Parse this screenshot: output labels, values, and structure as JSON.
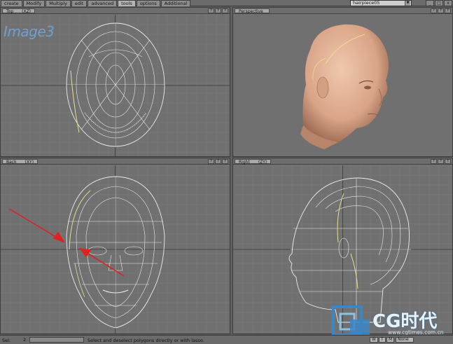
{
  "tabs": [
    {
      "label": "create",
      "active": false
    },
    {
      "label": "Modify",
      "active": false
    },
    {
      "label": "Multiply",
      "active": false
    },
    {
      "label": "edit",
      "active": false
    },
    {
      "label": "advanced",
      "active": false
    },
    {
      "label": "tools",
      "active": true
    },
    {
      "label": "options",
      "active": false
    },
    {
      "label": "Additional",
      "active": false
    }
  ],
  "layer_dropdown": {
    "value": "hairpiece05",
    "icon": "chevron-down-icon"
  },
  "window_buttons": [
    "_",
    "□",
    "x"
  ],
  "watermark": "Image3",
  "viewports": {
    "top": {
      "name": "Top",
      "axes": "(XZ)",
      "buttons": [
        "?",
        "?",
        "?"
      ]
    },
    "perspective": {
      "name": "Perspective",
      "buttons": [
        "?",
        "?",
        "?"
      ]
    },
    "back": {
      "name": "Back",
      "axes": "(XY)",
      "buttons": [
        "?",
        "?",
        "?"
      ]
    },
    "right": {
      "name": "Right",
      "axes": "(ZY)",
      "buttons": [
        "?",
        "?",
        "?"
      ]
    }
  },
  "status": {
    "label": "Sel:",
    "count": "2",
    "message": "Select and deselect polygons directly or with lasso.",
    "right_buttons": [
      "W",
      "T",
      "M",
      "None"
    ]
  },
  "logo": {
    "text": "CG时代",
    "url": "www.cgtimes.com.cn"
  },
  "colors": {
    "viewport_bg": "#707070",
    "grid": "#7c7c7c",
    "mesh": "#ececec",
    "hair_guide": "#e6e28a",
    "annotation_arrow": "#e0211e",
    "skin": "#e2b193",
    "watermark": "#6f9fd3",
    "logo_blue": "#3b86c4"
  }
}
